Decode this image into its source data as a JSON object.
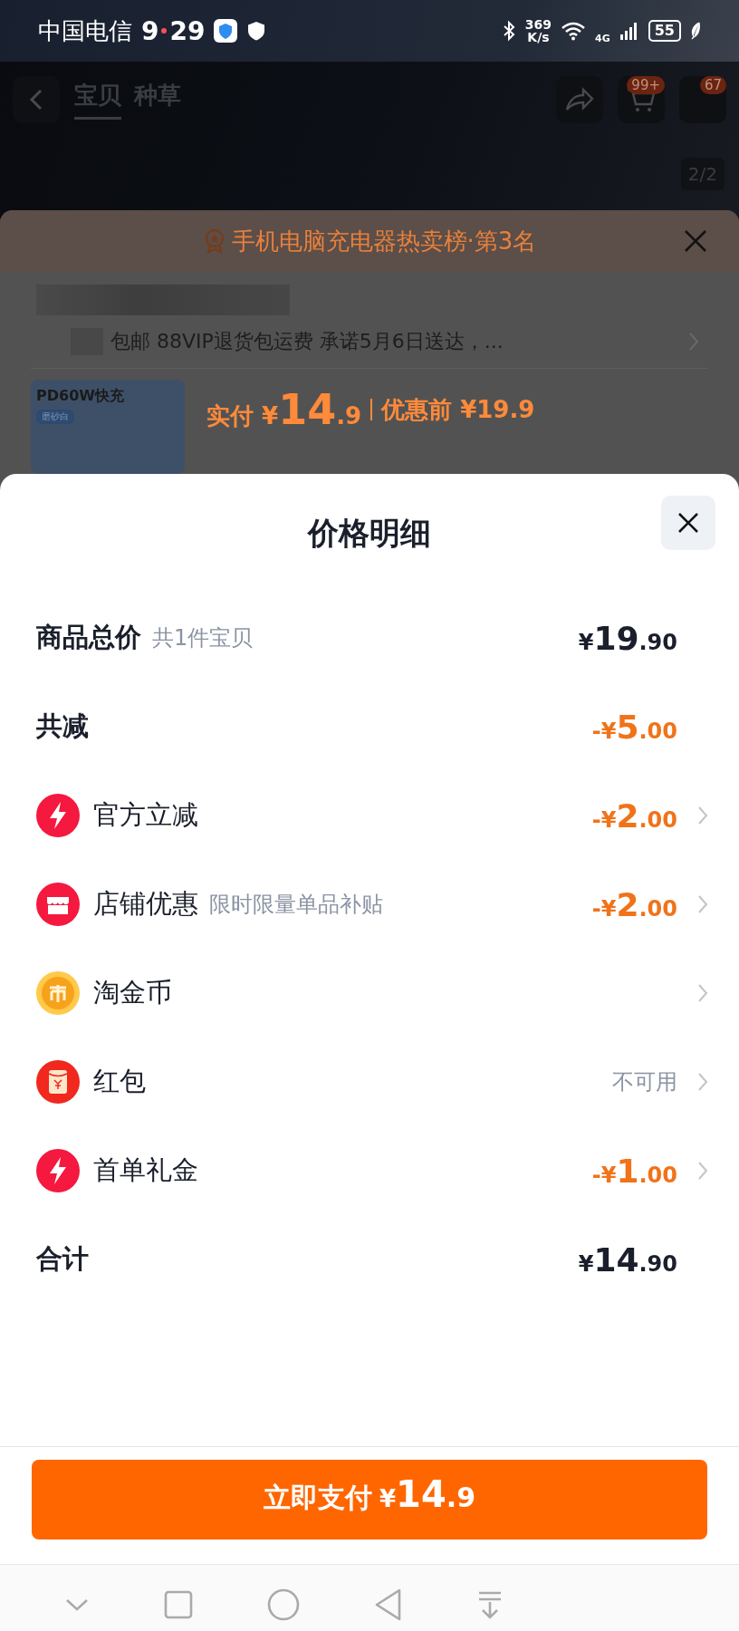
{
  "status_bar": {
    "carrier": "中国电信",
    "time_hour": "9",
    "time_minute": "29",
    "net_speed_value": "369",
    "net_speed_unit": "K/s",
    "network": "4G",
    "battery": "55"
  },
  "background": {
    "tabs": [
      {
        "label": "宝贝",
        "selected": true
      },
      {
        "label": "种草",
        "selected": false
      }
    ],
    "cart_badge": "99+",
    "message_badge": "67",
    "image_counter": "2/2",
    "ranking": "手机电脑充电器热卖榜·第3名",
    "shipping": "包邮 88VIP退货包运费 承诺5月6日送达，...",
    "thumb_title": "PD60W快充",
    "thumb_tag": "磨砂白",
    "paid_label": "实付",
    "paid_prefix": "¥",
    "paid_whole": "14",
    "paid_fraction": ".9",
    "original_label": "优惠前",
    "original_price": "¥19.9"
  },
  "sheet": {
    "title": "价格明细",
    "rows": [
      {
        "kind": "summary",
        "label": "商品总价",
        "note": "共1件宝贝",
        "highlight": false,
        "amount": {
          "prefix": "¥",
          "whole": "19",
          "fraction": ".90"
        }
      },
      {
        "kind": "summary",
        "label": "共减",
        "highlight": true,
        "amount": {
          "prefix": "-¥",
          "whole": "5",
          "fraction": ".00"
        }
      },
      {
        "kind": "bolt",
        "label": "官方立减",
        "highlight": true,
        "amount": {
          "prefix": "-¥",
          "whole": "2",
          "fraction": ".00"
        }
      },
      {
        "kind": "shop",
        "label": "店铺优惠",
        "note": "限时限量单品补贴",
        "highlight": true,
        "amount": {
          "prefix": "-¥",
          "whole": "2",
          "fraction": ".00"
        }
      },
      {
        "kind": "coin",
        "label": "淘金币"
      },
      {
        "kind": "envelope",
        "label": "红包",
        "status": "不可用"
      },
      {
        "kind": "bolt",
        "label": "首单礼金",
        "highlight": true,
        "amount": {
          "prefix": "-¥",
          "whole": "1",
          "fraction": ".00"
        }
      },
      {
        "kind": "summary",
        "label": "合计",
        "highlight": false,
        "amount": {
          "prefix": "¥",
          "whole": "14",
          "fraction": ".90"
        }
      }
    ],
    "pay_button": {
      "label": "立即支付",
      "prefix": "¥",
      "whole": "14",
      "fraction": ".9"
    }
  }
}
